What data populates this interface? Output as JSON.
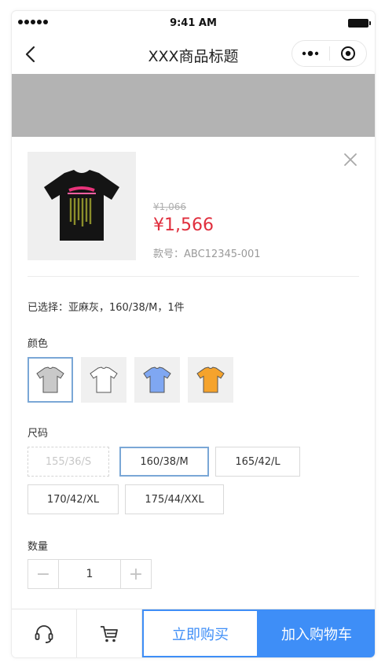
{
  "status_bar": {
    "time": "9:41 AM"
  },
  "nav": {
    "title": "XXX商品标题"
  },
  "product": {
    "price_original": "¥1,066",
    "price_current": "¥1,566",
    "style_no": "款号：ABC12345-001"
  },
  "selection": {
    "summary": "已选择：亚麻灰，160/38/M，1件"
  },
  "color_section": {
    "label": "颜色",
    "options": [
      {
        "name": "gray-tshirt",
        "fill": "#c9c9c9",
        "selected": true
      },
      {
        "name": "white-tshirt",
        "fill": "#ffffff",
        "selected": false
      },
      {
        "name": "blue-tshirt",
        "fill": "#7fa7f2",
        "selected": false
      },
      {
        "name": "orange-tshirt",
        "fill": "#f5a32c",
        "selected": false
      }
    ]
  },
  "size_section": {
    "label": "尺码",
    "options": [
      {
        "label": "155/36/S",
        "state": "disabled"
      },
      {
        "label": "160/38/M",
        "state": "selected"
      },
      {
        "label": "165/42/L",
        "state": "normal"
      },
      {
        "label": "170/42/XL",
        "state": "normal"
      },
      {
        "label": "175/44/XXL",
        "state": "normal"
      }
    ]
  },
  "quantity_section": {
    "label": "数量",
    "minus": "−",
    "value": "1",
    "plus": "+"
  },
  "bottom_bar": {
    "buy_now": "立即购买",
    "add_to_cart": "加入购物车"
  },
  "colors": {
    "accent": "#3e8ef7",
    "price": "#e02e3d",
    "banner": "#b3b3b3"
  }
}
